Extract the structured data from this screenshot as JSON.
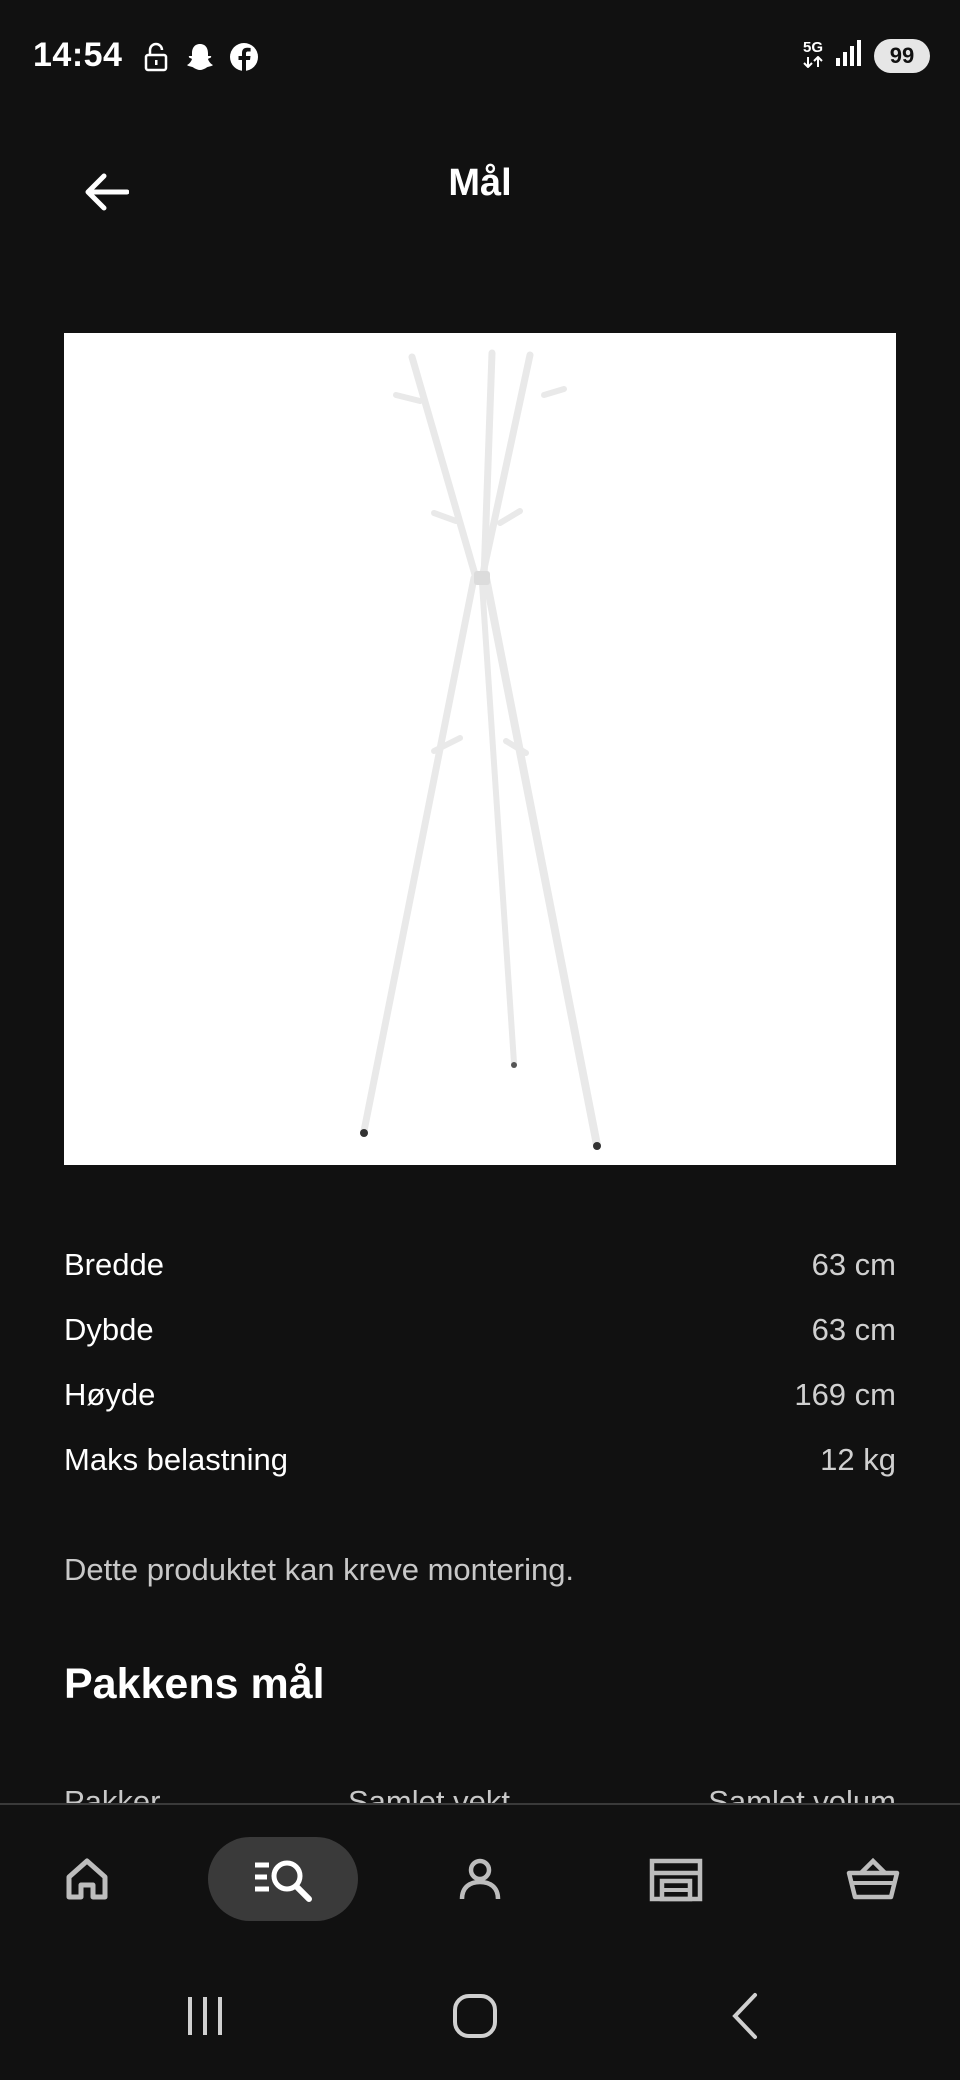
{
  "status_bar": {
    "time": "14:54",
    "network": "5G",
    "battery": "99",
    "left_icons": [
      "lock-open-icon",
      "snapchat-icon",
      "facebook-icon"
    ],
    "right_icons": [
      "5g-icon",
      "signal-icon",
      "battery-icon"
    ]
  },
  "header": {
    "title": "Mål",
    "back_icon": "arrow-left-icon"
  },
  "product_image": {
    "subject": "coat-stand"
  },
  "dimensions": [
    {
      "label": "Bredde",
      "value": "63 cm"
    },
    {
      "label": "Dybde",
      "value": "63 cm"
    },
    {
      "label": "Høyde",
      "value": "169 cm"
    },
    {
      "label": "Maks belastning",
      "value": "12 kg"
    }
  ],
  "note": "Dette produktet kan kreve montering.",
  "package_section": {
    "title": "Pakkens mål",
    "columns": [
      "Pakker",
      "Samlet vekt",
      "Samlet volum"
    ]
  },
  "bottom_nav": {
    "items": [
      {
        "icon": "home-icon",
        "active": false
      },
      {
        "icon": "search-icon",
        "active": true
      },
      {
        "icon": "profile-icon",
        "active": false
      },
      {
        "icon": "store-icon",
        "active": false
      },
      {
        "icon": "basket-icon",
        "active": false
      }
    ]
  },
  "system_nav": [
    "recent-apps-icon",
    "home-circle-icon",
    "back-chevron-icon"
  ],
  "colors": {
    "background": "#111111",
    "text": "#ffffff",
    "muted_text": "#c8c8c8",
    "active_pill": "#3a3a3a",
    "image_bg": "#ffffff"
  }
}
